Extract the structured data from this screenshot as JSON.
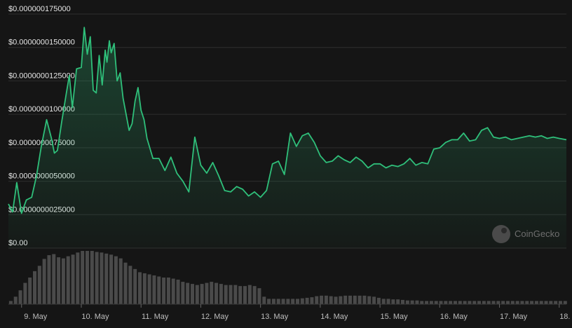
{
  "watermark": {
    "text": "CoinGecko",
    "icon": "coingecko-gecko-icon"
  },
  "colors": {
    "background": "#151515",
    "line": "#2fbf7a",
    "grid": "#2e2e2e",
    "volume": "#4a4a4a"
  },
  "chart_data": {
    "type": "line",
    "title": "",
    "xlabel": "",
    "ylabel": "",
    "y_ticks": [
      "$0.00",
      "$0.0000000025000",
      "$0.0000000050000",
      "$0.0000000075000",
      "$0.0000000100000",
      "$0.0000000125000",
      "$0.0000000150000",
      "$0.000000175000"
    ],
    "y_tick_values": [
      0,
      2.5e-08,
      5e-08,
      7.5e-08,
      1e-07,
      1.25e-07,
      1.5e-07,
      1.75e-07
    ],
    "ylim": [
      0,
      1.75e-07
    ],
    "x_ticks": [
      "9. May",
      "10. May",
      "11. May",
      "12. May",
      "13. May",
      "14. May",
      "15. May",
      "16. May",
      "17. May",
      "18. May"
    ],
    "x_tick_days": [
      9,
      10,
      11,
      12,
      13,
      14,
      15,
      16,
      17,
      18
    ],
    "xlim_days": [
      8.78,
      18.12
    ],
    "grid": true,
    "series": [
      {
        "x_days": [
          8.78,
          8.85,
          8.92,
          9.0,
          9.08,
          9.17,
          9.25,
          9.33,
          9.42,
          9.5,
          9.55,
          9.6,
          9.67,
          9.75,
          9.8,
          9.85,
          9.92,
          10.0,
          10.05,
          10.1,
          10.15,
          10.2,
          10.25,
          10.3,
          10.35,
          10.4,
          10.43,
          10.47,
          10.5,
          10.55,
          10.6,
          10.65,
          10.7,
          10.75,
          10.8,
          10.85,
          10.9,
          10.95,
          11.0,
          11.05,
          11.1,
          11.2,
          11.3,
          11.4,
          11.5,
          11.6,
          11.7,
          11.8,
          11.9,
          12.0,
          12.1,
          12.2,
          12.3,
          12.4,
          12.5,
          12.6,
          12.7,
          12.8,
          12.9,
          13.0,
          13.1,
          13.2,
          13.3,
          13.4,
          13.5,
          13.6,
          13.7,
          13.8,
          13.9,
          14.0,
          14.1,
          14.2,
          14.3,
          14.4,
          14.5,
          14.6,
          14.7,
          14.8,
          14.9,
          15.0,
          15.1,
          15.2,
          15.3,
          15.4,
          15.5,
          15.6,
          15.7,
          15.8,
          15.9,
          16.0,
          16.1,
          16.2,
          16.3,
          16.4,
          16.5,
          16.6,
          16.7,
          16.8,
          16.9,
          17.0,
          17.1,
          17.2,
          17.3,
          17.4,
          17.5,
          17.6,
          17.7,
          17.8,
          17.9,
          18.0,
          18.12
        ],
        "values": [
          3.3e-08,
          2.7e-08,
          4.9e-08,
          2.6e-08,
          3.6e-08,
          3.8e-08,
          5.4e-08,
          7.6e-08,
          9.6e-08,
          8.2e-08,
          7.1e-08,
          7.3e-08,
          9.4e-08,
          1.16e-07,
          1.29e-07,
          1.05e-07,
          1.34e-07,
          1.35e-07,
          1.65e-07,
          1.45e-07,
          1.58e-07,
          1.18e-07,
          1.16e-07,
          1.44e-07,
          1.22e-07,
          1.48e-07,
          1.39e-07,
          1.55e-07,
          1.46e-07,
          1.53e-07,
          1.25e-07,
          1.31e-07,
          1.12e-07,
          1e-07,
          8.8e-08,
          9.3e-08,
          1.1e-07,
          1.2e-07,
          1.03e-07,
          9.6e-08,
          8.2e-08,
          6.7e-08,
          6.7e-08,
          5.8e-08,
          6.8e-08,
          5.6e-08,
          5e-08,
          4.2e-08,
          8.3e-08,
          6.2e-08,
          5.6e-08,
          6.4e-08,
          5.4e-08,
          4.3e-08,
          4.2e-08,
          4.6e-08,
          4.4e-08,
          3.9e-08,
          4.2e-08,
          3.8e-08,
          4.3e-08,
          6.3e-08,
          6.5e-08,
          5.5e-08,
          8.6e-08,
          7.6e-08,
          8.4e-08,
          8.6e-08,
          7.9e-08,
          6.9e-08,
          6.4e-08,
          6.5e-08,
          6.9e-08,
          6.6e-08,
          6.4e-08,
          6.8e-08,
          6.5e-08,
          6e-08,
          6.3e-08,
          6.3e-08,
          6e-08,
          6.2e-08,
          6.1e-08,
          6.3e-08,
          6.7e-08,
          6.2e-08,
          6.4e-08,
          6.3e-08,
          7.4e-08,
          7.5e-08,
          7.9e-08,
          8.1e-08,
          8.1e-08,
          8.6e-08,
          8e-08,
          8.1e-08,
          8.8e-08,
          9e-08,
          8.3e-08,
          8.2e-08,
          8.3e-08,
          8.1e-08,
          8.2e-08,
          8.3e-08,
          8.4e-08,
          8.3e-08,
          8.4e-08,
          8.2e-08,
          8.3e-08,
          8.2e-08,
          8.1e-08,
          8.2e-08,
          8.1e-08
        ]
      }
    ],
    "volume": {
      "x_days": [
        8.82,
        8.9,
        8.98,
        9.06,
        9.14,
        9.22,
        9.3,
        9.38,
        9.46,
        9.54,
        9.62,
        9.7,
        9.78,
        9.86,
        9.94,
        10.02,
        10.1,
        10.18,
        10.26,
        10.34,
        10.42,
        10.5,
        10.58,
        10.66,
        10.74,
        10.82,
        10.9,
        10.98,
        11.06,
        11.14,
        11.22,
        11.3,
        11.38,
        11.46,
        11.54,
        11.62,
        11.7,
        11.78,
        11.86,
        11.94,
        12.02,
        12.1,
        12.18,
        12.26,
        12.34,
        12.42,
        12.5,
        12.58,
        12.66,
        12.74,
        12.82,
        12.9,
        12.98,
        13.06,
        13.14,
        13.22,
        13.3,
        13.38,
        13.46,
        13.54,
        13.62,
        13.7,
        13.78,
        13.86,
        13.94,
        14.02,
        14.1,
        14.18,
        14.26,
        14.34,
        14.42,
        14.5,
        14.58,
        14.66,
        14.74,
        14.82,
        14.9,
        14.98,
        15.06,
        15.14,
        15.22,
        15.3,
        15.38,
        15.46,
        15.54,
        15.62,
        15.7,
        15.78,
        15.86,
        15.94,
        16.02,
        16.1,
        16.18,
        16.26,
        16.34,
        16.42,
        16.5,
        16.58,
        16.66,
        16.74,
        16.82,
        16.9,
        16.98,
        17.06,
        17.14,
        17.22,
        17.3,
        17.38,
        17.46,
        17.54,
        17.62,
        17.7,
        17.78,
        17.86,
        17.94,
        18.02,
        18.1
      ],
      "values": [
        0.06,
        0.14,
        0.26,
        0.4,
        0.5,
        0.62,
        0.72,
        0.85,
        0.92,
        0.94,
        0.88,
        0.86,
        0.9,
        0.93,
        0.97,
        1.0,
        1.0,
        1.0,
        0.98,
        0.97,
        0.95,
        0.93,
        0.9,
        0.86,
        0.78,
        0.72,
        0.66,
        0.6,
        0.58,
        0.56,
        0.54,
        0.52,
        0.5,
        0.5,
        0.48,
        0.46,
        0.42,
        0.4,
        0.38,
        0.36,
        0.38,
        0.4,
        0.42,
        0.4,
        0.38,
        0.36,
        0.36,
        0.36,
        0.34,
        0.34,
        0.36,
        0.34,
        0.3,
        0.14,
        0.1,
        0.1,
        0.1,
        0.1,
        0.1,
        0.1,
        0.1,
        0.11,
        0.12,
        0.13,
        0.15,
        0.16,
        0.16,
        0.15,
        0.14,
        0.15,
        0.16,
        0.16,
        0.16,
        0.16,
        0.16,
        0.15,
        0.14,
        0.12,
        0.1,
        0.1,
        0.09,
        0.09,
        0.08,
        0.07,
        0.07,
        0.07,
        0.06,
        0.06,
        0.06,
        0.06,
        0.06,
        0.06,
        0.06,
        0.06,
        0.06,
        0.06,
        0.06,
        0.06,
        0.06,
        0.06,
        0.06,
        0.06,
        0.06,
        0.06,
        0.06,
        0.06,
        0.06,
        0.06,
        0.06,
        0.06,
        0.06,
        0.06,
        0.06,
        0.06,
        0.06,
        0.06,
        0.06
      ]
    }
  }
}
